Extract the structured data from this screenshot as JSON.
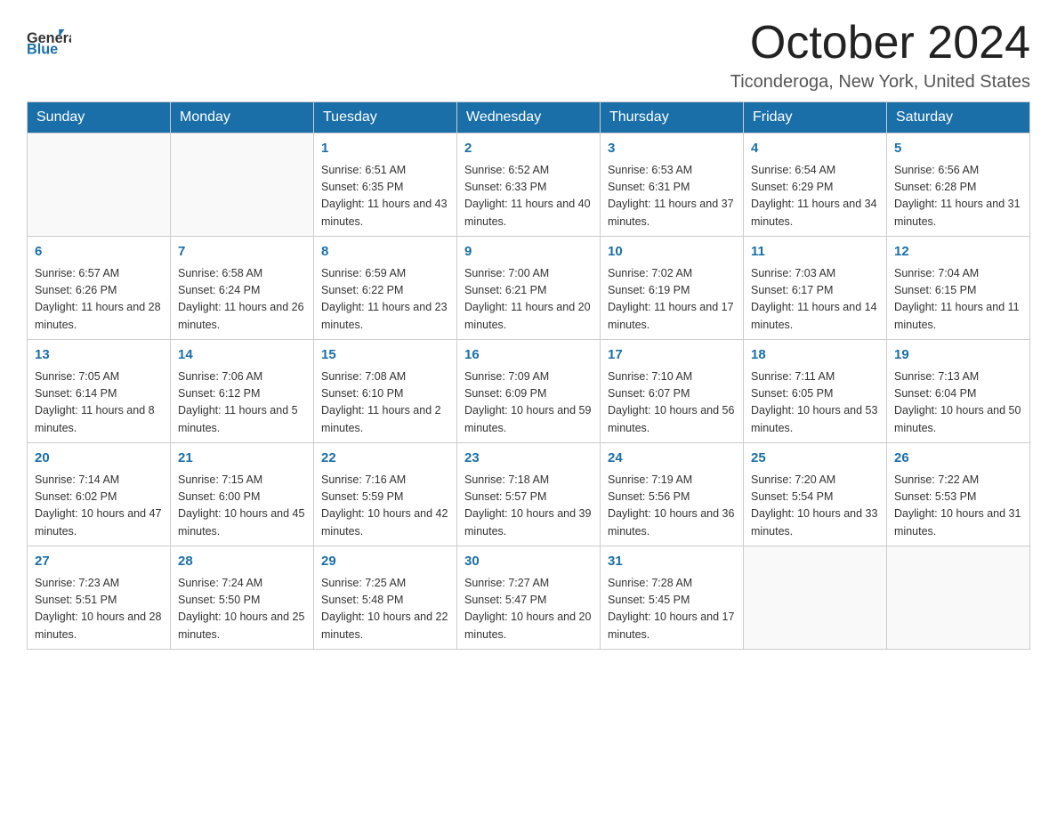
{
  "header": {
    "logo_general": "General",
    "logo_blue": "Blue",
    "month": "October 2024",
    "location": "Ticonderoga, New York, United States"
  },
  "weekdays": [
    "Sunday",
    "Monday",
    "Tuesday",
    "Wednesday",
    "Thursday",
    "Friday",
    "Saturday"
  ],
  "weeks": [
    [
      {
        "day": "",
        "sunrise": "",
        "sunset": "",
        "daylight": ""
      },
      {
        "day": "",
        "sunrise": "",
        "sunset": "",
        "daylight": ""
      },
      {
        "day": "1",
        "sunrise": "Sunrise: 6:51 AM",
        "sunset": "Sunset: 6:35 PM",
        "daylight": "Daylight: 11 hours and 43 minutes."
      },
      {
        "day": "2",
        "sunrise": "Sunrise: 6:52 AM",
        "sunset": "Sunset: 6:33 PM",
        "daylight": "Daylight: 11 hours and 40 minutes."
      },
      {
        "day": "3",
        "sunrise": "Sunrise: 6:53 AM",
        "sunset": "Sunset: 6:31 PM",
        "daylight": "Daylight: 11 hours and 37 minutes."
      },
      {
        "day": "4",
        "sunrise": "Sunrise: 6:54 AM",
        "sunset": "Sunset: 6:29 PM",
        "daylight": "Daylight: 11 hours and 34 minutes."
      },
      {
        "day": "5",
        "sunrise": "Sunrise: 6:56 AM",
        "sunset": "Sunset: 6:28 PM",
        "daylight": "Daylight: 11 hours and 31 minutes."
      }
    ],
    [
      {
        "day": "6",
        "sunrise": "Sunrise: 6:57 AM",
        "sunset": "Sunset: 6:26 PM",
        "daylight": "Daylight: 11 hours and 28 minutes."
      },
      {
        "day": "7",
        "sunrise": "Sunrise: 6:58 AM",
        "sunset": "Sunset: 6:24 PM",
        "daylight": "Daylight: 11 hours and 26 minutes."
      },
      {
        "day": "8",
        "sunrise": "Sunrise: 6:59 AM",
        "sunset": "Sunset: 6:22 PM",
        "daylight": "Daylight: 11 hours and 23 minutes."
      },
      {
        "day": "9",
        "sunrise": "Sunrise: 7:00 AM",
        "sunset": "Sunset: 6:21 PM",
        "daylight": "Daylight: 11 hours and 20 minutes."
      },
      {
        "day": "10",
        "sunrise": "Sunrise: 7:02 AM",
        "sunset": "Sunset: 6:19 PM",
        "daylight": "Daylight: 11 hours and 17 minutes."
      },
      {
        "day": "11",
        "sunrise": "Sunrise: 7:03 AM",
        "sunset": "Sunset: 6:17 PM",
        "daylight": "Daylight: 11 hours and 14 minutes."
      },
      {
        "day": "12",
        "sunrise": "Sunrise: 7:04 AM",
        "sunset": "Sunset: 6:15 PM",
        "daylight": "Daylight: 11 hours and 11 minutes."
      }
    ],
    [
      {
        "day": "13",
        "sunrise": "Sunrise: 7:05 AM",
        "sunset": "Sunset: 6:14 PM",
        "daylight": "Daylight: 11 hours and 8 minutes."
      },
      {
        "day": "14",
        "sunrise": "Sunrise: 7:06 AM",
        "sunset": "Sunset: 6:12 PM",
        "daylight": "Daylight: 11 hours and 5 minutes."
      },
      {
        "day": "15",
        "sunrise": "Sunrise: 7:08 AM",
        "sunset": "Sunset: 6:10 PM",
        "daylight": "Daylight: 11 hours and 2 minutes."
      },
      {
        "day": "16",
        "sunrise": "Sunrise: 7:09 AM",
        "sunset": "Sunset: 6:09 PM",
        "daylight": "Daylight: 10 hours and 59 minutes."
      },
      {
        "day": "17",
        "sunrise": "Sunrise: 7:10 AM",
        "sunset": "Sunset: 6:07 PM",
        "daylight": "Daylight: 10 hours and 56 minutes."
      },
      {
        "day": "18",
        "sunrise": "Sunrise: 7:11 AM",
        "sunset": "Sunset: 6:05 PM",
        "daylight": "Daylight: 10 hours and 53 minutes."
      },
      {
        "day": "19",
        "sunrise": "Sunrise: 7:13 AM",
        "sunset": "Sunset: 6:04 PM",
        "daylight": "Daylight: 10 hours and 50 minutes."
      }
    ],
    [
      {
        "day": "20",
        "sunrise": "Sunrise: 7:14 AM",
        "sunset": "Sunset: 6:02 PM",
        "daylight": "Daylight: 10 hours and 47 minutes."
      },
      {
        "day": "21",
        "sunrise": "Sunrise: 7:15 AM",
        "sunset": "Sunset: 6:00 PM",
        "daylight": "Daylight: 10 hours and 45 minutes."
      },
      {
        "day": "22",
        "sunrise": "Sunrise: 7:16 AM",
        "sunset": "Sunset: 5:59 PM",
        "daylight": "Daylight: 10 hours and 42 minutes."
      },
      {
        "day": "23",
        "sunrise": "Sunrise: 7:18 AM",
        "sunset": "Sunset: 5:57 PM",
        "daylight": "Daylight: 10 hours and 39 minutes."
      },
      {
        "day": "24",
        "sunrise": "Sunrise: 7:19 AM",
        "sunset": "Sunset: 5:56 PM",
        "daylight": "Daylight: 10 hours and 36 minutes."
      },
      {
        "day": "25",
        "sunrise": "Sunrise: 7:20 AM",
        "sunset": "Sunset: 5:54 PM",
        "daylight": "Daylight: 10 hours and 33 minutes."
      },
      {
        "day": "26",
        "sunrise": "Sunrise: 7:22 AM",
        "sunset": "Sunset: 5:53 PM",
        "daylight": "Daylight: 10 hours and 31 minutes."
      }
    ],
    [
      {
        "day": "27",
        "sunrise": "Sunrise: 7:23 AM",
        "sunset": "Sunset: 5:51 PM",
        "daylight": "Daylight: 10 hours and 28 minutes."
      },
      {
        "day": "28",
        "sunrise": "Sunrise: 7:24 AM",
        "sunset": "Sunset: 5:50 PM",
        "daylight": "Daylight: 10 hours and 25 minutes."
      },
      {
        "day": "29",
        "sunrise": "Sunrise: 7:25 AM",
        "sunset": "Sunset: 5:48 PM",
        "daylight": "Daylight: 10 hours and 22 minutes."
      },
      {
        "day": "30",
        "sunrise": "Sunrise: 7:27 AM",
        "sunset": "Sunset: 5:47 PM",
        "daylight": "Daylight: 10 hours and 20 minutes."
      },
      {
        "day": "31",
        "sunrise": "Sunrise: 7:28 AM",
        "sunset": "Sunset: 5:45 PM",
        "daylight": "Daylight: 10 hours and 17 minutes."
      },
      {
        "day": "",
        "sunrise": "",
        "sunset": "",
        "daylight": ""
      },
      {
        "day": "",
        "sunrise": "",
        "sunset": "",
        "daylight": ""
      }
    ]
  ]
}
